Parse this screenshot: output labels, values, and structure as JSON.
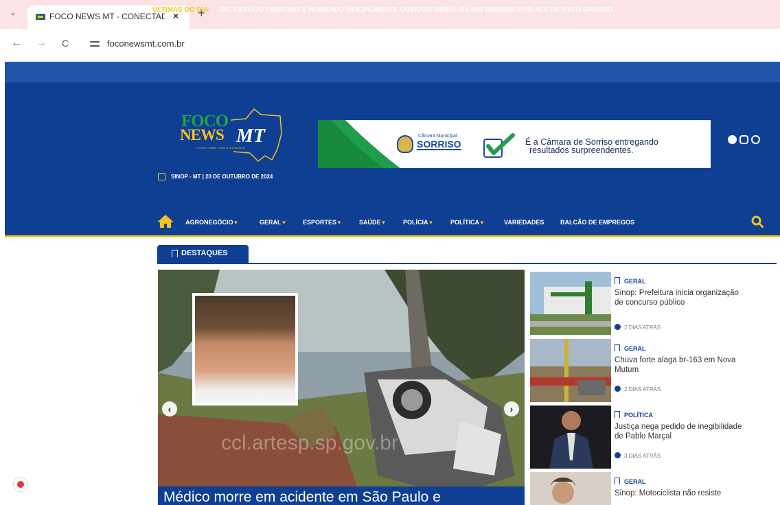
{
  "browser": {
    "tab_title": "FOCO NEWS MT - CONECTADO COM A VERDADE",
    "tab_close": "×",
    "new_tab": "+",
    "url": "foconewsmt.com.br",
    "back": "←",
    "forward": "→",
    "reload": "C"
  },
  "ticker": {
    "label": "ÚLTIMAS DO DIA:",
    "text": "DR. GETÚLIO PEDROSO É NOMEADO OFICIALMENTE OUVIDOR GERAL DA DEFENSORIA PÚBLICA DE MATO GROSSO"
  },
  "header": {
    "logo": {
      "foco": "FOCO",
      "news": "NEWS",
      "mt": "MT",
      "tagline": "CONECTADO COM A VERDADE"
    },
    "date": "SINOP - MT | 20 DE OUTUBRO DE 2024",
    "ad": {
      "camara": "Câmara Municipal",
      "city": "SORRISO",
      "slogan_line1": "É a Câmara de Sorriso entregando",
      "slogan_line2": "resultados surpreendentes."
    },
    "social_icons": [
      "facebook-icon",
      "instagram-icon",
      "whatsapp-icon"
    ]
  },
  "nav": {
    "items": [
      {
        "label": "AGRONEGÓCIO",
        "dropdown": true
      },
      {
        "label": "GERAL",
        "dropdown": true
      },
      {
        "label": "ESPORTES",
        "dropdown": true
      },
      {
        "label": "SAÚDE",
        "dropdown": true
      },
      {
        "label": "POLÍCIA",
        "dropdown": true
      },
      {
        "label": "POLÍTICA",
        "dropdown": true
      },
      {
        "label": "VARIEDADES",
        "dropdown": false
      },
      {
        "label": "BALCÃO DE EMPREGOS",
        "dropdown": false
      }
    ],
    "caret": "▼"
  },
  "highlights": {
    "tab_label": "DESTAQUES",
    "hero": {
      "title": "Médico morre em acidente em São Paulo e",
      "watermark": "ccl.artesp.sp.gov.br"
    },
    "side": [
      {
        "category": "GERAL",
        "title": "Sinop: Prefeitura inicia organização de concurso público",
        "time": "2 DIAS ATRÁS"
      },
      {
        "category": "GERAL",
        "title": "Chuva forte alaga br-163 em Nova Mutum",
        "time": "2 DIAS ATRÁS"
      },
      {
        "category": "POLÍTICA",
        "title": "Justiça nega pedido de inegibilidade de Pablo Marçal",
        "time": "3 DIAS ATRÁS"
      },
      {
        "category": "GERAL",
        "title": "Sinop: Motociclista não resiste",
        "time": ""
      }
    ]
  },
  "colors": {
    "primary_blue": "#0e3f93",
    "ticker_blue": "#1f56a9",
    "accent_yellow": "#f4c11f",
    "logo_green": "#20a446",
    "tab_strip": "#fbe3e6"
  }
}
